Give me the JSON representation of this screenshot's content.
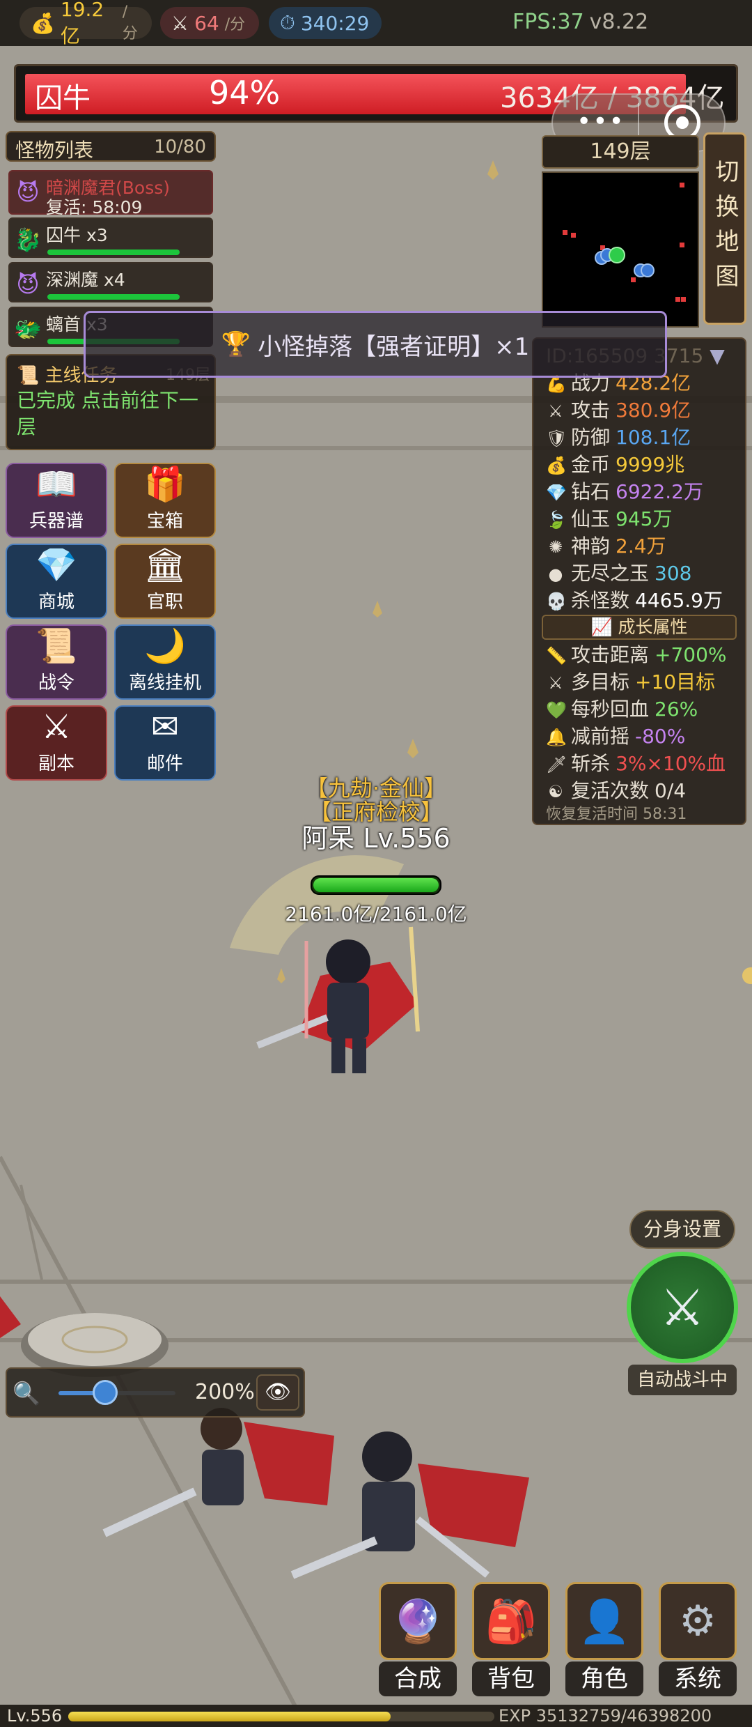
{
  "topbar": {
    "gold_rate": "19.2亿",
    "gold_unit": "/分",
    "kill_rate": "64",
    "kill_unit": "/分",
    "timer": "340:29",
    "fps": "FPS:37",
    "version": "v8.22"
  },
  "boss": {
    "name": "囚牛",
    "percent": "94%",
    "hp_text": "3634亿 / 3864亿",
    "hp_fraction": 0.94
  },
  "monster_list": {
    "title": "怪物列表",
    "count": "10/80",
    "items": [
      {
        "name": "暗渊魔君(Boss)",
        "sub": "复活: 58:09",
        "icon": "demon-icon"
      },
      {
        "name": "囚牛 x3",
        "icon": "dragon-icon",
        "hp_fraction": 1.0
      },
      {
        "name": "深渊魔 x4",
        "icon": "demon-icon",
        "hp_fraction": 1.0
      },
      {
        "name": "螭首 x3",
        "icon": "dragon-head-icon",
        "hp_fraction": 1.0
      }
    ]
  },
  "quest": {
    "title": "主线任务",
    "floor_hint": "149层",
    "desc": "已完成 点击前往下一层"
  },
  "toast": {
    "text": "小怪掉落【强者证明】×1"
  },
  "menu": [
    {
      "label": "兵器谱",
      "icon": "book-icon",
      "color": "#4a2d4f",
      "border": "#8a5aa0"
    },
    {
      "label": "宝箱",
      "icon": "giftbox-icon",
      "color": "#5a3a20",
      "border": "#b58a40"
    },
    {
      "label": "商城",
      "icon": "diamond-icon",
      "color": "#1e3855",
      "border": "#4b7fbf"
    },
    {
      "label": "官职",
      "icon": "court-icon",
      "color": "#5a3a20",
      "border": "#b58a40"
    },
    {
      "label": "战令",
      "icon": "scroll-icon",
      "color": "#4a2d4f",
      "border": "#8a5aa0"
    },
    {
      "label": "离线挂机",
      "icon": "moon-icon",
      "color": "#1e3855",
      "border": "#4b7fbf"
    },
    {
      "label": "副本",
      "icon": "swords-icon",
      "color": "#5a2222",
      "border": "#b04a4a"
    },
    {
      "label": "邮件",
      "icon": "mail-icon",
      "color": "#1e3855",
      "border": "#4b7fbf"
    }
  ],
  "map": {
    "floor": "149层",
    "switch_label": "切换地图"
  },
  "stats": {
    "id": "ID:165509 3715",
    "rows": [
      {
        "label": "战力",
        "value": "428.2亿",
        "color": "#f2a23b",
        "icon": "fist-icon"
      },
      {
        "label": "攻击",
        "value": "380.9亿",
        "color": "#f07a3a",
        "icon": "sword-icon"
      },
      {
        "label": "防御",
        "value": "108.1亿",
        "color": "#5aa7f2",
        "icon": "shield-icon"
      },
      {
        "label": "金币",
        "value": "9999兆",
        "color": "#f5c93a",
        "icon": "coinbag-icon"
      },
      {
        "label": "钻石",
        "value": "6922.2万",
        "color": "#c583f0",
        "icon": "diamond-icon"
      },
      {
        "label": "仙玉",
        "value": "945万",
        "color": "#7ee36f",
        "icon": "jade-icon"
      },
      {
        "label": "神韵",
        "value": "2.4万",
        "color": "#f2a23b",
        "icon": "orb-icon"
      },
      {
        "label": "无尽之玉",
        "value": "308",
        "color": "#5ec8e8",
        "icon": "gem-icon"
      },
      {
        "label": "杀怪数",
        "value": "4465.9万",
        "color": "#ffffff",
        "icon": "skull-icon"
      }
    ],
    "growth_label": "成长属性",
    "growth": [
      {
        "label": "攻击距离",
        "value": "+700%",
        "color": "#7ee36f",
        "icon": "ruler-icon"
      },
      {
        "label": "多目标",
        "value": "+10目标",
        "color": "#f5c93a",
        "icon": "swords-icon"
      },
      {
        "label": "每秒回血",
        "value": "26%",
        "color": "#7ee36f",
        "icon": "heart-icon"
      },
      {
        "label": "减前摇",
        "value": "-80%",
        "color": "#c583f0",
        "icon": "bell-icon"
      },
      {
        "label": "斩杀",
        "value": "3%×10%血",
        "color": "#f05050",
        "icon": "dagger-icon"
      },
      {
        "label": "复活次数",
        "value": "0/4",
        "color": "#e6dfd3",
        "icon": "yinyang-icon"
      }
    ],
    "revive_time": "恢复复活时间 58:31"
  },
  "player": {
    "title1": "【九劫·金仙】",
    "title2": "【正府检校】",
    "name": "阿呆 Lv.556",
    "hp": "2161.0亿/2161.0亿",
    "hp_fraction": 1.0
  },
  "clone_settings": "分身设置",
  "auto_fight": "自动战斗中",
  "zoom": {
    "value": "200%",
    "slider_fraction": 0.4
  },
  "bottom_buttons": [
    {
      "label": "合成",
      "icon": "crystal-ball-icon"
    },
    {
      "label": "背包",
      "icon": "backpack-icon"
    },
    {
      "label": "角色",
      "icon": "person-icon"
    },
    {
      "label": "系统",
      "icon": "gear-icon"
    }
  ],
  "exp": {
    "level": "Lv.556",
    "text": "EXP 35132759/46398200 (75.7%)",
    "fraction": 0.757
  }
}
